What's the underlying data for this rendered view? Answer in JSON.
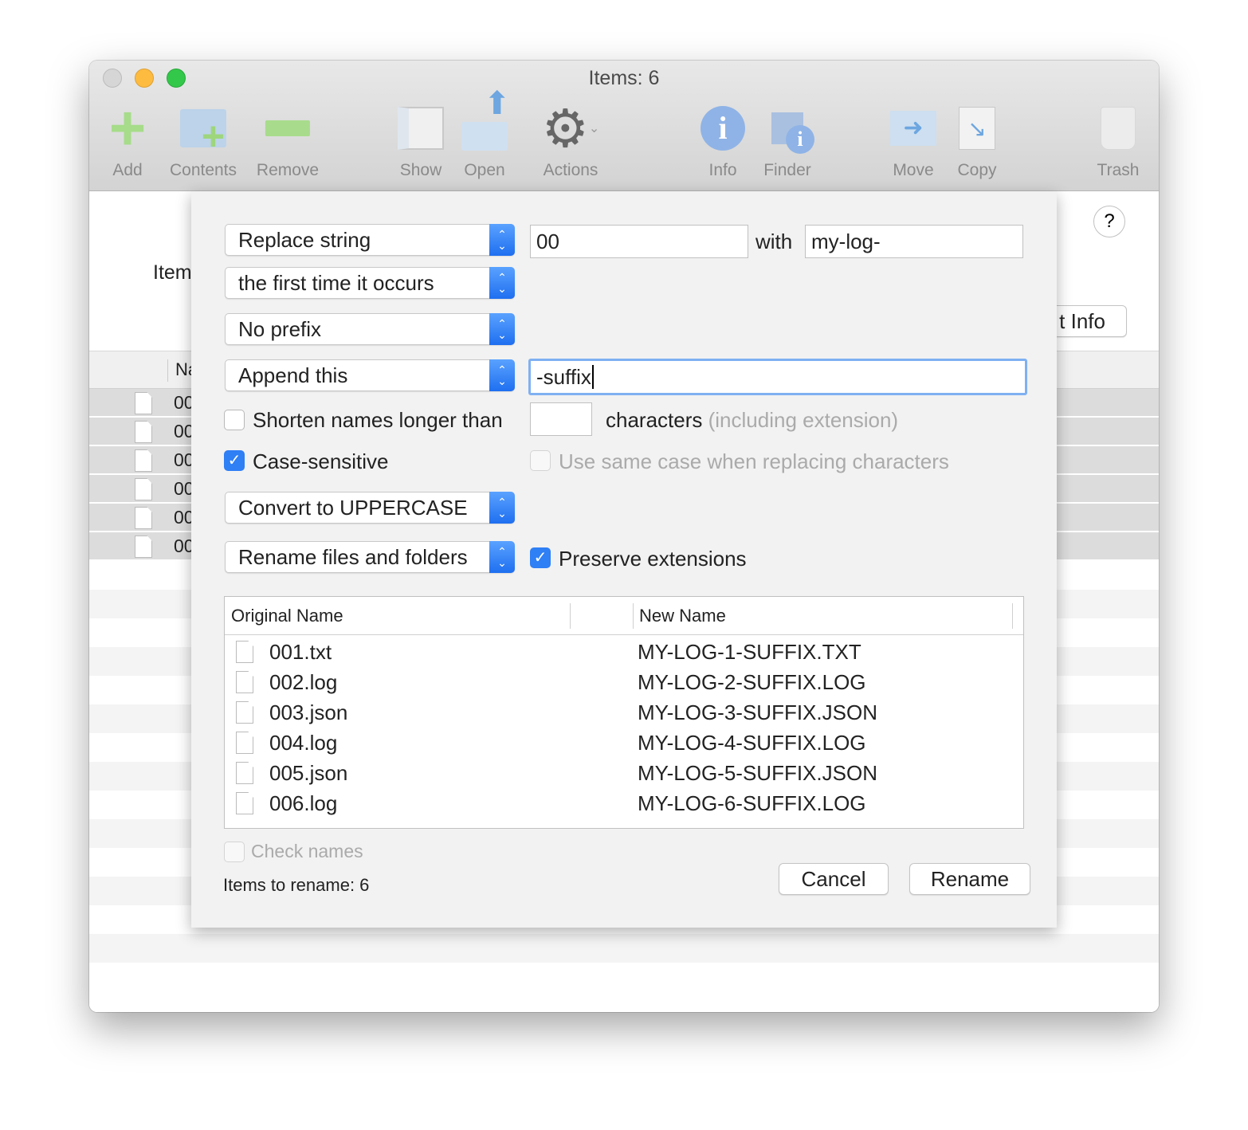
{
  "window": {
    "title": "Items: 6"
  },
  "toolbar": [
    {
      "label": "Add",
      "icon": "plus-icon"
    },
    {
      "label": "Contents",
      "icon": "folder-add-icon"
    },
    {
      "label": "Remove",
      "icon": "minus-icon"
    },
    {
      "label": "Show",
      "icon": "window-icon"
    },
    {
      "label": "Open",
      "icon": "open-folder-icon"
    },
    {
      "label": "Actions",
      "icon": "gear-icon"
    },
    {
      "label": "Info",
      "icon": "info-icon"
    },
    {
      "label": "Finder",
      "icon": "finder-info-icon"
    },
    {
      "label": "Move",
      "icon": "move-icon"
    },
    {
      "label": "Copy",
      "icon": "copy-icon"
    },
    {
      "label": "Trash",
      "icon": "trash-icon"
    }
  ],
  "background": {
    "items_label": "Item",
    "name_header": "Na",
    "get_info_label": "t Info",
    "help": "?",
    "rows": [
      "00",
      "00",
      "00",
      "00",
      "00",
      "00"
    ]
  },
  "sheet": {
    "mode": "Replace string",
    "find": "00",
    "with_label": "with",
    "replace": "my-log-",
    "occurrence": "the first time it occurs",
    "prefix": "No prefix",
    "suffix_mode": "Append this",
    "suffix": "-suffix",
    "shorten_label": "Shorten names longer than",
    "shorten_value": "",
    "characters_label": "characters",
    "characters_note": "(including extension)",
    "case_sensitive_label": "Case-sensitive",
    "case_sensitive": true,
    "same_case_label": "Use same case when replacing characters",
    "same_case": false,
    "case_conversion": "Convert to UPPERCASE",
    "target": "Rename files and folders",
    "preserve_label": "Preserve extensions",
    "preserve": true,
    "table": {
      "headers": [
        "Original Name",
        "New Name"
      ],
      "rows": [
        {
          "original": "001.txt",
          "new": "MY-LOG-1-SUFFIX.TXT"
        },
        {
          "original": "002.log",
          "new": "MY-LOG-2-SUFFIX.LOG"
        },
        {
          "original": "003.json",
          "new": "MY-LOG-3-SUFFIX.JSON"
        },
        {
          "original": "004.log",
          "new": "MY-LOG-4-SUFFIX.LOG"
        },
        {
          "original": "005.json",
          "new": "MY-LOG-5-SUFFIX.JSON"
        },
        {
          "original": "006.log",
          "new": "MY-LOG-6-SUFFIX.LOG"
        }
      ]
    },
    "check_names_label": "Check names",
    "check_names": false,
    "items_to_rename": "Items to rename: 6",
    "cancel": "Cancel",
    "rename": "Rename"
  },
  "colors": {
    "accent": "#2f7ff5",
    "close": "#d0d0d0",
    "minimize": "#fdbc40",
    "zoom": "#34c84a"
  }
}
